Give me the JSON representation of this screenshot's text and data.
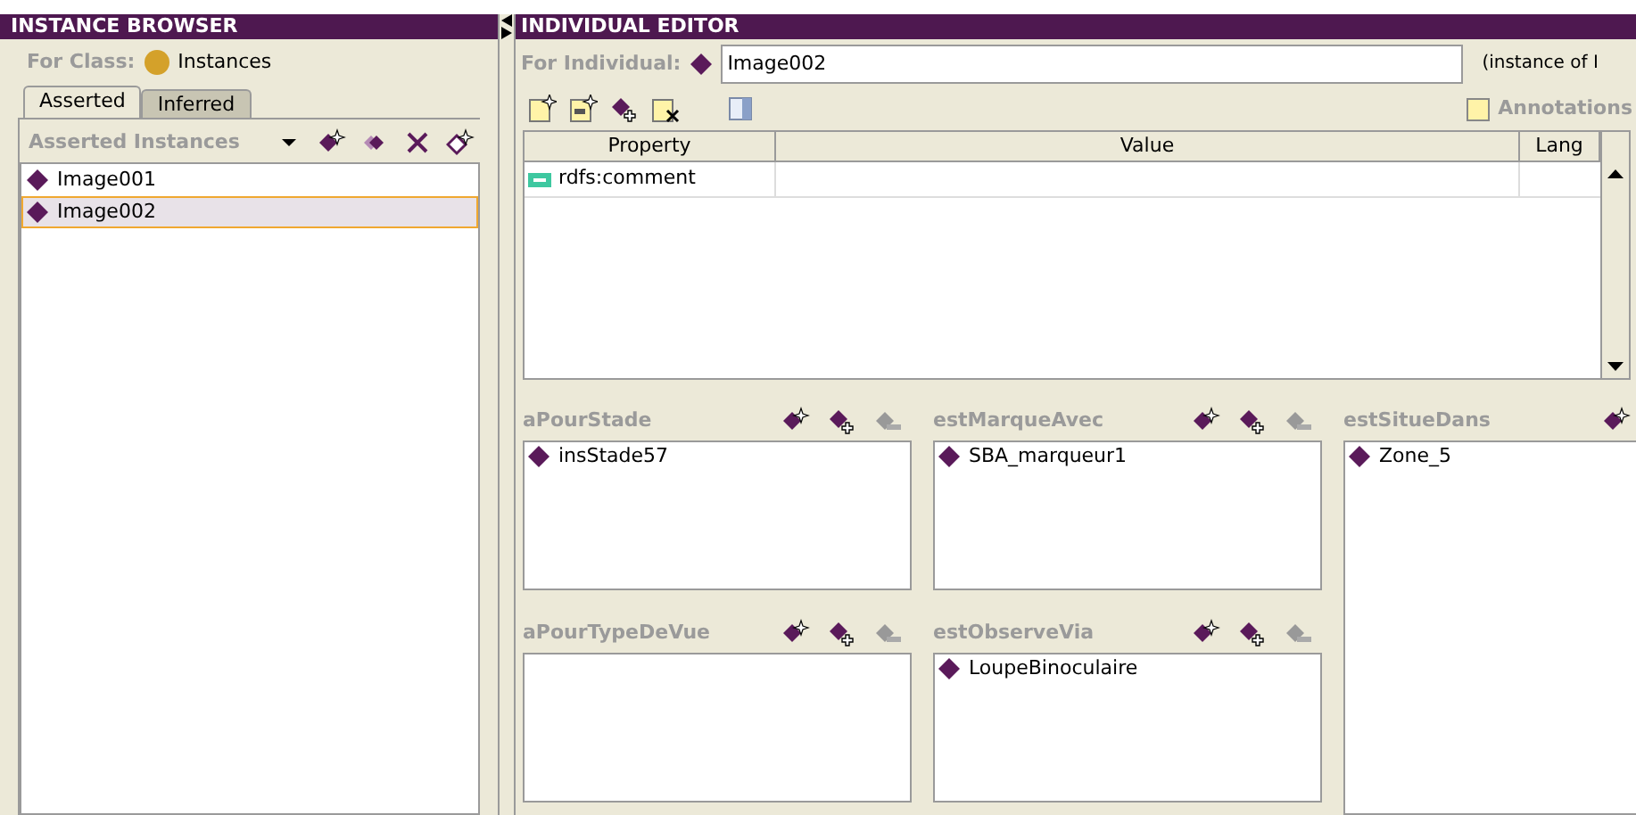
{
  "instance_browser": {
    "title": "INSTANCE BROWSER",
    "for_class_label": "For Class:",
    "class_name": "Instances",
    "tabs": [
      {
        "label": "Asserted",
        "selected": true
      },
      {
        "label": "Inferred",
        "selected": false
      }
    ],
    "list_title": "Asserted Instances",
    "instances": [
      {
        "name": "Image001",
        "selected": false
      },
      {
        "name": "Image002",
        "selected": true
      }
    ]
  },
  "individual_editor": {
    "title": "INDIVIDUAL EDITOR",
    "for_label": "For Individual:",
    "individual": "Image002",
    "instance_of": "(instance of I",
    "annotations_label": "Annotations",
    "columns": [
      "Property",
      "Value",
      "Lang"
    ],
    "rows": [
      {
        "property": "rdfs:comment"
      }
    ],
    "property_panels": [
      {
        "name": "aPourStade",
        "values": [
          "insStade57"
        ]
      },
      {
        "name": "estMarqueAvec",
        "values": [
          "SBA_marqueur1"
        ]
      },
      {
        "name": "estSitueDans",
        "values": [
          "Zone_5"
        ]
      },
      {
        "name": "aPourTypeDeVue"
      },
      {
        "name": "estObserveVia",
        "values": [
          "LoupeBinoculaire"
        ]
      }
    ]
  }
}
